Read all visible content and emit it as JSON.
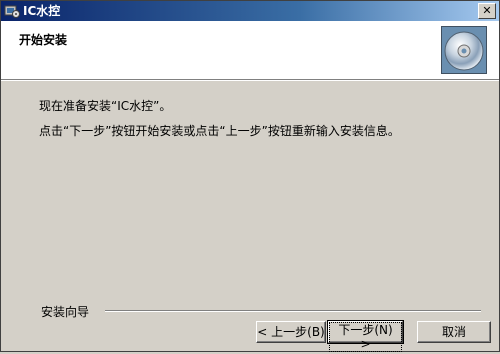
{
  "window": {
    "title": "IC水控"
  },
  "header": {
    "title": "开始安装"
  },
  "body": {
    "line1": "现在准备安装“IC水控”。",
    "line2": "点击“下一步”按钮开始安装或点击“上一步”按钮重新输入安装信息。"
  },
  "footer": {
    "label": "安装向导",
    "back_label": "< 上一步(B)",
    "next_label": "下一步(N) >",
    "cancel_label": "取消"
  },
  "icons": {
    "title": "installer-app-icon",
    "header": "cd-disc-icon",
    "close": "close-icon"
  }
}
